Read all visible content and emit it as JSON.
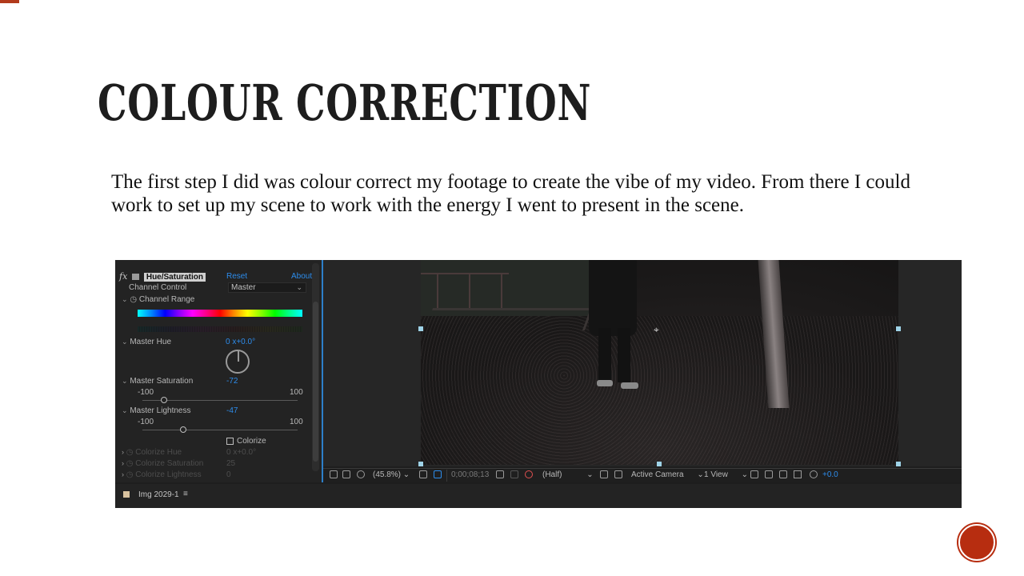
{
  "slide": {
    "title": "Colour Correction",
    "body": "The first step I did was colour correct my footage to create the vibe of my video. From there I could work to set up my scene to work with the energy I went to present in the scene."
  },
  "effect_controls": {
    "fx_symbol": "fx",
    "effect_name": "Hue/Saturation",
    "reset_label": "Reset",
    "about_label": "About",
    "channel_control_label": "Channel Control",
    "channel_control_value": "Master",
    "channel_range_label": "Channel Range",
    "master_hue_label": "Master Hue",
    "master_hue_value": "0 x+0.0°",
    "master_saturation_label": "Master Saturation",
    "master_saturation_value": "-72",
    "saturation_min": "-100",
    "saturation_max": "100",
    "master_lightness_label": "Master Lightness",
    "master_lightness_value": "-47",
    "lightness_min": "-100",
    "lightness_max": "100",
    "colorize_label": "Colorize",
    "colorize_hue_label": "Colorize Hue",
    "colorize_hue_value": "0 x+0.0°",
    "colorize_saturation_label": "Colorize Saturation",
    "colorize_saturation_value": "25",
    "colorize_lightness_label": "Colorize Lightness",
    "colorize_lightness_value": "0"
  },
  "viewer_toolbar": {
    "zoom": "(45.8%)",
    "timecode": "0;00;08;13",
    "resolution": "(Half)",
    "camera": "Active Camera",
    "view": "1 View",
    "exposure": "+0.0"
  },
  "composition": {
    "name": "Img 2029-1",
    "menu_icon": "≡"
  },
  "colors": {
    "accent": "#b72d10",
    "panel_highlight": "#2d7fc9",
    "value_blue": "#2d8ceb"
  }
}
